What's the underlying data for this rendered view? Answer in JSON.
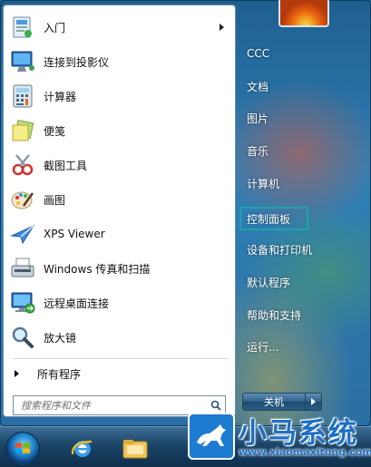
{
  "start_menu": {
    "programs": [
      {
        "label": "入门",
        "icon": "getting-started-icon",
        "has_submenu": true
      },
      {
        "label": "连接到投影仪",
        "icon": "projector-icon",
        "has_submenu": false
      },
      {
        "label": "计算器",
        "icon": "calculator-icon",
        "has_submenu": false
      },
      {
        "label": "便笺",
        "icon": "sticky-notes-icon",
        "has_submenu": false
      },
      {
        "label": "截图工具",
        "icon": "snipping-tool-icon",
        "has_submenu": false
      },
      {
        "label": "画图",
        "icon": "paint-icon",
        "has_submenu": false
      },
      {
        "label": "XPS Viewer",
        "icon": "xps-viewer-icon",
        "has_submenu": false
      },
      {
        "label": "Windows 传真和扫描",
        "icon": "fax-scan-icon",
        "has_submenu": false
      },
      {
        "label": "远程桌面连接",
        "icon": "remote-desktop-icon",
        "has_submenu": false
      },
      {
        "label": "放大镜",
        "icon": "magnifier-icon",
        "has_submenu": false
      }
    ],
    "all_programs_label": "所有程序",
    "search": {
      "placeholder": "搜索程序和文件",
      "value": ""
    },
    "right_links": [
      {
        "label": "CCC",
        "highlighted": false
      },
      {
        "label": "文档",
        "highlighted": false
      },
      {
        "label": "图片",
        "highlighted": false
      },
      {
        "label": "音乐",
        "highlighted": false
      },
      {
        "label": "计算机",
        "highlighted": false
      },
      {
        "label": "控制面板",
        "highlighted": true
      },
      {
        "label": "设备和打印机",
        "highlighted": false
      },
      {
        "label": "默认程序",
        "highlighted": false
      },
      {
        "label": "帮助和支持",
        "highlighted": false
      },
      {
        "label": "运行...",
        "highlighted": false
      }
    ],
    "shutdown_label": "关机"
  },
  "taskbar": {
    "icons": [
      "windows-start-orb-icon",
      "internet-explorer-icon",
      "windows-explorer-icon"
    ]
  },
  "watermark": {
    "title": "小马系统",
    "url": "www.xiaomaxitong.com"
  },
  "colors": {
    "highlight_border": "#1fa3a8",
    "watermark_blue": "#1b6fc4"
  }
}
